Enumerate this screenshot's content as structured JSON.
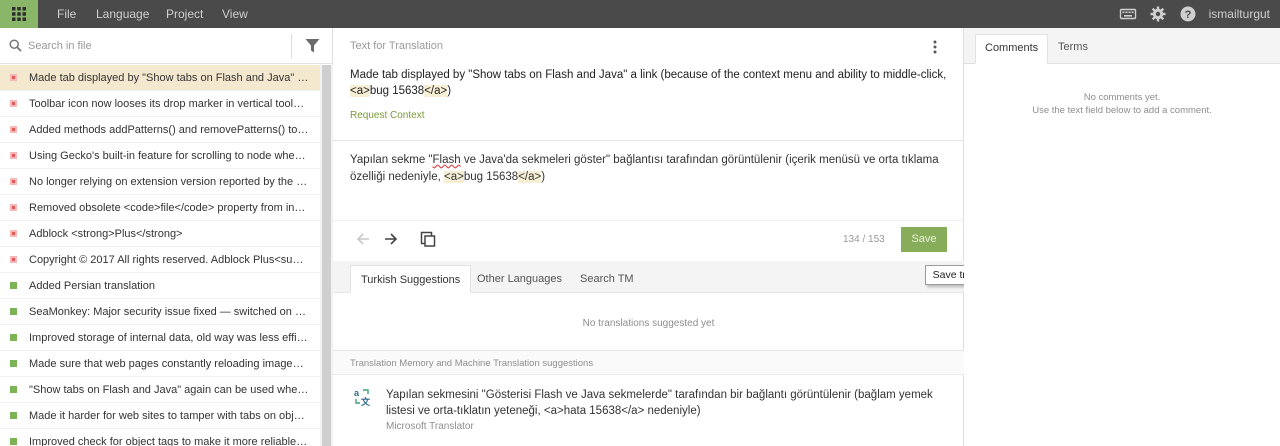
{
  "topbar": {
    "menu": [
      "File",
      "Language",
      "Project",
      "View"
    ],
    "username": "ismailturgut",
    "icons": [
      "apps-grid-icon",
      "keyboard-icon",
      "gear-icon",
      "help-icon"
    ]
  },
  "search": {
    "placeholder": "Search in file"
  },
  "strings": [
    {
      "text": "Made tab displayed by \"Show tabs on Flash and Java\" a link (because of the context menu and ability to middle-click, <a>bug 15638</a>)",
      "status": "missing",
      "active": true
    },
    {
      "text": "Toolbar icon now looses its drop marker in vertical toolbars...",
      "status": "missing"
    },
    {
      "text": "Added methods addPatterns() and removePatterns() to the ...",
      "status": "missing"
    },
    {
      "text": "Using Gecko's built-in feature for scrolling to node when sel...",
      "status": "missing"
    },
    {
      "text": "No longer relying on extension version reported by the bro...",
      "status": "missing"
    },
    {
      "text": "Removed obsolete <code>file</code> property from install ...",
      "status": "missing"
    },
    {
      "text": "Adblock <strong>Plus</strong>",
      "status": "missing"
    },
    {
      "text": "Copyright © 2017 All rights reserved. Adblock Plus<sup>®<...",
      "status": "missing"
    },
    {
      "text": "Added Persian translation",
      "status": "translated"
    },
    {
      "text": "SeaMonkey: Major security issue fixed — switched on XPCN...",
      "status": "translated"
    },
    {
      "text": "Improved storage of internal data, old way was less efficient...",
      "status": "translated"
    },
    {
      "text": "Made sure that web pages constantly reloading images wo...",
      "status": "translated"
    },
    {
      "text": "\"Show tabs on Flash and Java\" again can be used when Java...",
      "status": "translated"
    },
    {
      "text": "Made it harder for web sites to tamper with tabs on objects ...",
      "status": "translated"
    },
    {
      "text": "Improved check for object tags to make it more reliable abo...",
      "status": "translated"
    }
  ],
  "editor": {
    "source_label": "Text for Translation",
    "source_text": "Made tab displayed by \"Show tabs on Flash and Java\" a link (because of the context menu and ability to middle-click,",
    "source_tag_open": "<a>",
    "source_tag_mid": "bug 15638",
    "source_tag_close": "</a>",
    "source_end": ")",
    "request_context": "Request Context",
    "translation_pre": "Yapılan sekme \"",
    "translation_spell": "Flash",
    "translation_post": " ve Java'da sekmeleri göster\" bağlantısı tarafından görüntülenir (içerik menüsü ve orta tıklama özelliği nedeniyle, ",
    "translation_tag_open": "<a>",
    "translation_tag_mid": "bug 15638",
    "translation_tag_close": "</a>",
    "translation_end": ")",
    "counter": "134 / 153",
    "save_label": "Save"
  },
  "tooltip": "Save translation (Ctrl+Enter)",
  "helpers": {
    "tabs": [
      "Turkish Suggestions",
      "Other Languages",
      "Search TM"
    ],
    "no_translations": "No translations suggested yet",
    "tm_label": "Translation Memory and Machine Translation suggestions",
    "suggestion_text": "Yapılan sekmesini \"Gösterisi Flash ve Java sekmelerde\" tarafından bir bağlantı görüntülenir (bağlam yemek listesi ve orta-tıklatın yeteneği, <a>hata 15638</a> nedeniyle)",
    "suggestion_source": "Microsoft Translator"
  },
  "right": {
    "tabs": [
      "Comments",
      "Terms"
    ],
    "no_comments": "No comments yet.",
    "hint": "Use the text field below to add a comment."
  },
  "colors": {
    "accent": "#8ab66a",
    "topbar": "#4a4a4a",
    "missing": "#e15a5a",
    "translated": "#7bb356"
  }
}
